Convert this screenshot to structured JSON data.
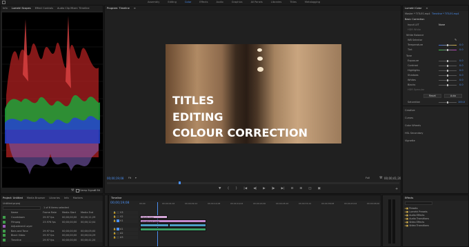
{
  "workspace_tabs": [
    "Assembly",
    "Editing",
    "Color",
    "Effects",
    "Audio",
    "Graphics",
    "All Panels",
    "Libraries",
    "Titles",
    "Metalogging"
  ],
  "active_workspace": "Color",
  "scopes": {
    "tabs": [
      "Lumetri Scopes",
      "Effect Controls",
      "Audio Clip Mixer: Timeline"
    ],
    "active_tab": "Lumetri Scopes",
    "left_tab": "Info",
    "footer_clamp": "Clamp Signal",
    "footer_bit": "8 Bit"
  },
  "program": {
    "tab": "Program: Timeline",
    "overlay_lines": [
      "TITLES",
      "EDITING",
      "COLOUR CORRECTION"
    ],
    "timecode_in": "00;00;19;08",
    "fit": "Fit",
    "quality": "Full",
    "timecode_out": "00;00;41;20"
  },
  "lumetri": {
    "title": "Lumetri Color",
    "breadcrumb": "Master * TITLES.mp4",
    "breadcrumb2": "Timeline * TITLES.mp4",
    "sections": [
      "Basic Correction",
      "Creative",
      "Curves",
      "Color Wheels",
      "HSL Secondary",
      "Vignette"
    ],
    "input_lut_label": "Input LUT",
    "input_lut_value": "None",
    "hdr_label": "HDR White",
    "white_balance": "White Balance",
    "wb_selector": "WB Selector",
    "temp_label": "Temperature",
    "temp_val": "0.0",
    "tint_label": "Tint",
    "tint_val": "0.0",
    "tone": "Tone",
    "tone_rows": [
      {
        "label": "Exposure",
        "value": "0.0"
      },
      {
        "label": "Contrast",
        "value": "0.0"
      },
      {
        "label": "Highlights",
        "value": "0.0"
      },
      {
        "label": "Shadows",
        "value": "0.0"
      },
      {
        "label": "Whites",
        "value": "0.0"
      },
      {
        "label": "Blacks",
        "value": "0.0"
      },
      {
        "label": "HDR Specular",
        "value": ""
      }
    ],
    "reset": "Reset",
    "auto": "Auto",
    "saturation_label": "Saturation",
    "saturation_val": "100.0"
  },
  "project": {
    "tabs": [
      "Project: Untitled",
      "Media Browser",
      "Libraries",
      "Info",
      "Markers"
    ],
    "file": "Untitled.prproj",
    "count": "1 of 6 items selected",
    "columns": [
      "Name",
      "Frame Rate",
      "Media Start",
      "Media End"
    ],
    "rows": [
      {
        "name": "Countdown",
        "fps": "29.97 fps",
        "start": "00;00;00;00",
        "end": "00;00;11;29",
        "color": "#3f9e4a"
      },
      {
        "name": "Ffmpeg",
        "fps": "23.976 fps",
        "start": "00;00;00;00",
        "end": "00;00;12;04",
        "color": "#3f9e4a"
      },
      {
        "name": "Adjustment Layer",
        "fps": "",
        "start": "",
        "end": "",
        "color": "#9b5ab8"
      },
      {
        "name": "Bars and Tone",
        "fps": "29.97 fps",
        "start": "00;00;00;00",
        "end": "00;00;05;00",
        "color": "#3f9e4a"
      },
      {
        "name": "Black Video",
        "fps": "29.97 fps",
        "start": "00;00;00;00",
        "end": "00;00;04;29",
        "color": "#3f9e4a"
      },
      {
        "name": "Timeline",
        "fps": "29.97 fps",
        "start": "00;00;00;00",
        "end": "00;00;41;20",
        "color": "#3f9e4a"
      }
    ]
  },
  "timeline": {
    "tab": "Timeline",
    "timecode": "00;00;19;08",
    "ruler": [
      "00;00",
      "00;00;04;16",
      "00;00;09;12",
      "00;00;14;08",
      "00;00;19;04",
      "00;00;24;00",
      "00;00;28;16",
      "00;00;33;12",
      "00;00;38;08",
      "00;00;43;04",
      "00;00;48;00"
    ],
    "tracks": [
      "V3",
      "V2",
      "V1",
      "A1",
      "A2",
      "A3"
    ],
    "clip_title": "TITLES.mp4",
    "clip_adjust": "Adjustment Layer"
  },
  "effects": {
    "tab": "Effects",
    "items": [
      "Presets",
      "Lumetri Presets",
      "Audio Effects",
      "Audio Transitions",
      "Video Effects",
      "Video Transitions"
    ]
  },
  "colors": {
    "accent": "#4b8ff0",
    "playhead": "#4b8ff0",
    "active_tab": "#e0e0e0"
  }
}
